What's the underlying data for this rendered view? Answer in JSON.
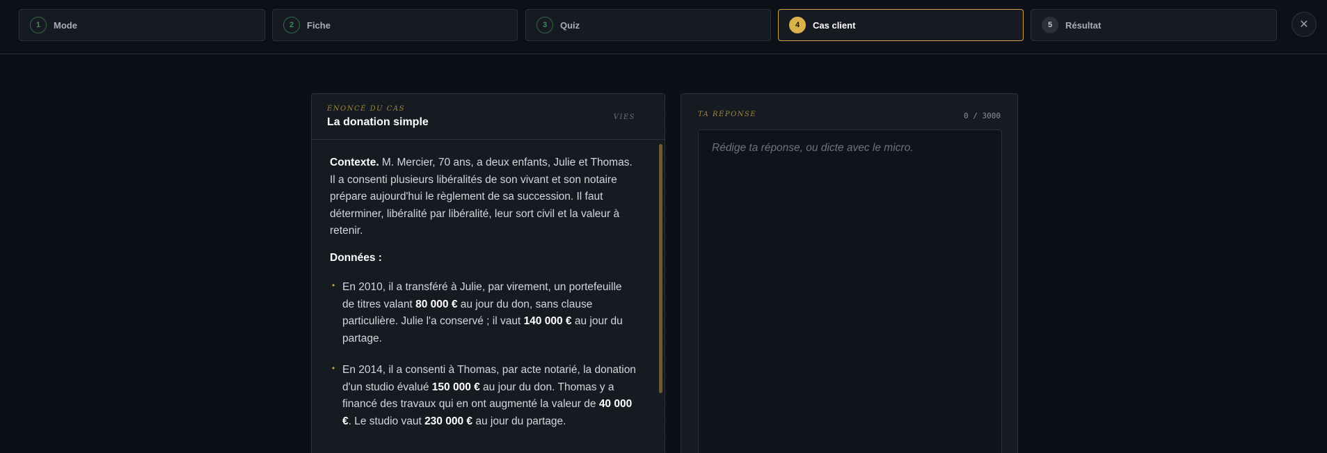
{
  "stepper": [
    {
      "num": "1",
      "label": "Mode",
      "state": "done"
    },
    {
      "num": "2",
      "label": "Fiche",
      "state": "done"
    },
    {
      "num": "3",
      "label": "Quiz",
      "state": "done"
    },
    {
      "num": "4",
      "label": "Cas client",
      "state": "active"
    },
    {
      "num": "5",
      "label": "Résultat",
      "state": "todo"
    }
  ],
  "close": {
    "icon": "close-icon",
    "glyph": "✕"
  },
  "case": {
    "eyebrow": "ÉNONCÉ DU CAS",
    "title": "La donation simple",
    "lives_label": "VIES",
    "context_label": "Contexte.",
    "context_text": " M. Mercier, 70 ans, a deux enfants, Julie et Thomas. Il a consenti plusieurs libéralités de son vivant et son notaire prépare aujourd'hui le règlement de sa succession. Il faut déterminer, libéralité par libéralité, leur sort civil et la valeur à retenir.",
    "donnees_label": "Données :",
    "bullets": [
      {
        "p1": "En 2010, il a transféré à Julie, par virement, un portefeuille de titres valant ",
        "b1": "80 000 €",
        "p2": " au jour du don, sans clause particulière. Julie l'a conservé ; il vaut ",
        "b2": "140 000 €",
        "p3": " au jour du partage."
      },
      {
        "p1": "En 2014, il a consenti à Thomas, par acte notarié, la donation d'un studio évalué ",
        "b1": "150 000 €",
        "p2": " au jour du don. Thomas y a financé des travaux qui en ont augmenté la valeur de ",
        "b2": "40 000 €",
        "p3": ". Le studio vaut ",
        "b3": "230 000 €",
        "p4": " au jour du partage."
      }
    ]
  },
  "answer": {
    "eyebrow": "TA RÉPONSE",
    "counter": "0 / 3000",
    "placeholder": "Rédige ta réponse, ou dicte avec le micro."
  },
  "colors": {
    "accent": "#d9b24a",
    "done": "#3f8b5a",
    "background": "#0c0f15"
  }
}
